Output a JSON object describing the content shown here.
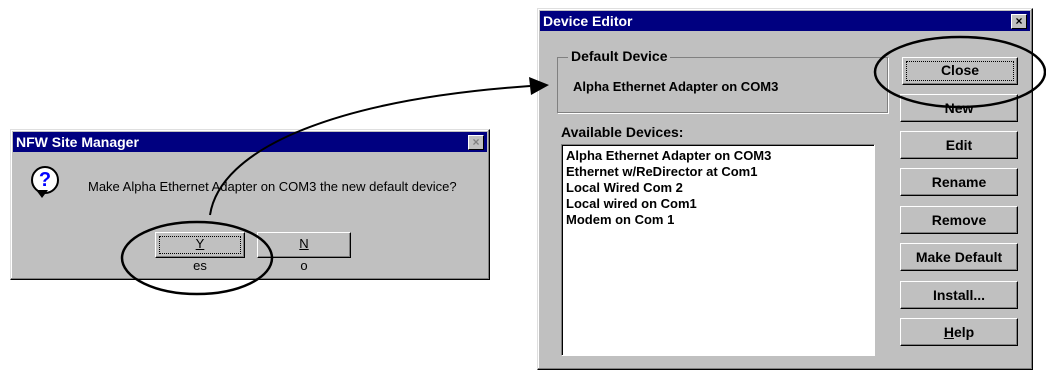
{
  "nfw_dialog": {
    "title": "NFW Site Manager",
    "close_glyph": "×",
    "icon": "question-icon",
    "icon_glyph": "?",
    "message": "Make Alpha Ethernet Adapter on COM3 the new default device?",
    "yes_mnemonic": "Y",
    "yes_rest": "es",
    "no_mnemonic": "N",
    "no_rest": "o"
  },
  "device_editor": {
    "title": "Device Editor",
    "close_glyph": "×",
    "default_group_label": "Default Device",
    "default_device": "Alpha Ethernet Adapter on COM3",
    "available_label": "Available Devices:",
    "devices": [
      "Alpha Ethernet Adapter on COM3",
      "Ethernet w/ReDirector at Com1",
      "Local Wired Com 2",
      "Local wired on Com1",
      "Modem on Com 1"
    ],
    "buttons": {
      "close": "Close",
      "new": "New",
      "edit": "Edit",
      "rename": "Rename",
      "remove": "Remove",
      "make_default": "Make Default",
      "install": "Install...",
      "help_mnemonic": "H",
      "help_rest": "elp"
    }
  }
}
